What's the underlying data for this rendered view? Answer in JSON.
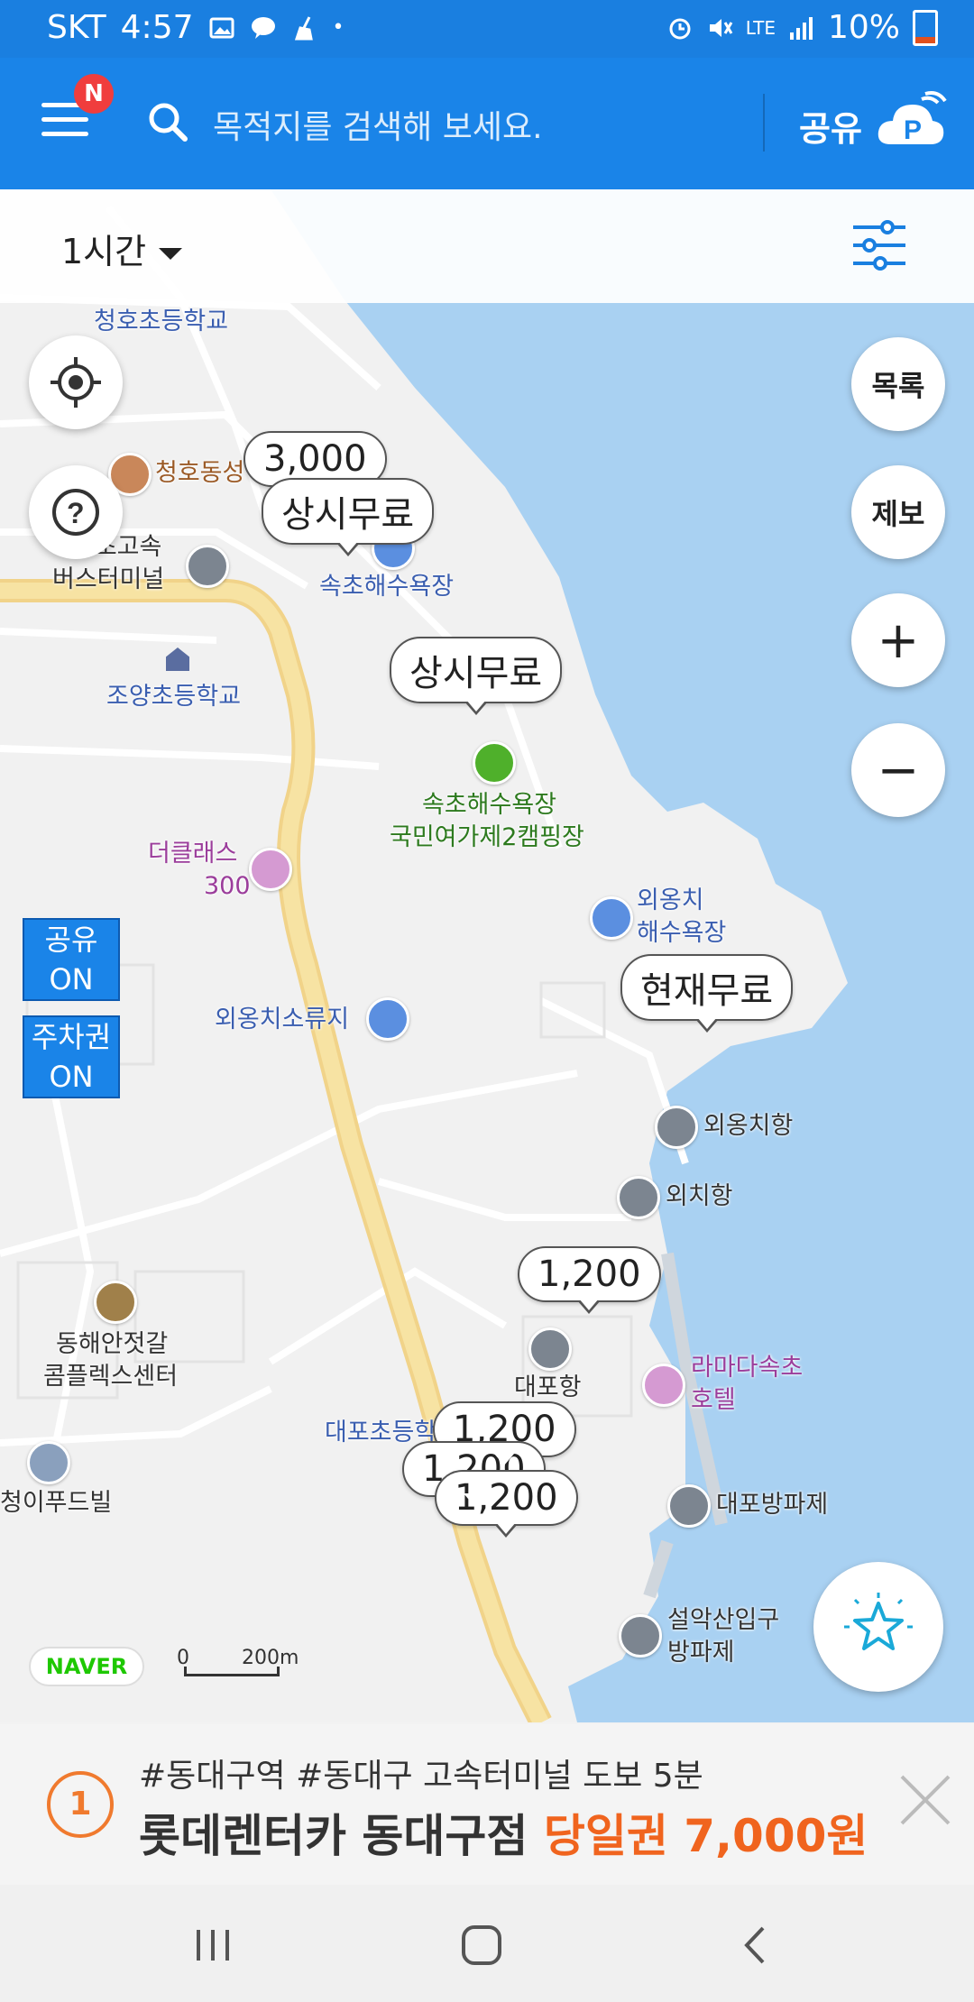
{
  "status_bar": {
    "carrier": "SKT",
    "time": "4:57",
    "network": "LTE",
    "battery": "10%"
  },
  "app_bar": {
    "notification_badge": "N",
    "search_placeholder": "목적지를 검색해 보세요.",
    "share_label": "공유"
  },
  "filter_bar": {
    "time_selector": "1시간"
  },
  "map": {
    "labels": {
      "cheongho_school": "청호초등학교",
      "cheongho_dong": "청호동성",
      "terminal_1": "속초고속",
      "terminal_2": "버스터미널",
      "sokcho_beach": "속초해수욕장",
      "joyang_school": "조양초등학교",
      "camp_1": "속초해수욕장",
      "camp_2": "국민여가제2캠핑장",
      "theclass_1": "더클래스",
      "theclass_2": "300",
      "oeongchi_beach_1": "외옹치",
      "oeongchi_beach_2": "해수욕장",
      "oeongchi_stream": "외옹치소류지",
      "oeongchi_port": "외옹치항",
      "oechi_port": "외치항",
      "complex_1": "동해안젓갈",
      "complex_2": "콤플렉스센터",
      "daepo_port": "대포항",
      "ramada_1": "라마다속초",
      "ramada_2": "호텔",
      "daepo_school": "대포초등학",
      "food_building": "청이푸드빌",
      "daepo_breakwater": "대포방파제",
      "seorak_1": "설악산입구",
      "seorak_2": "방파제"
    },
    "price_bubbles": [
      "3,000",
      "상시무료",
      "상시무료",
      "현재무료",
      "1,200",
      "1,200",
      "1,200",
      "1,200"
    ],
    "scale": {
      "zero": "0",
      "distance": "200m"
    },
    "naver_logo": "NAVER"
  },
  "side_buttons": {
    "list": "목록",
    "report": "제보",
    "zoom_in": "+",
    "zoom_out": "−"
  },
  "toggles": {
    "share_line1": "공유",
    "share_line2": "ON",
    "ticket_line1": "주차권",
    "ticket_line2": "ON"
  },
  "ad": {
    "rank": "1",
    "tags": "#동대구역  #동대구 고속터미널 도보 5분",
    "title": "롯데렌터카 동대구점",
    "price": "당일권 7,000원"
  },
  "colors": {
    "primary": "#1a84e8",
    "sea": "#a9d1f2",
    "road": "#f7e3a3",
    "ad_accent": "#f0641e"
  }
}
